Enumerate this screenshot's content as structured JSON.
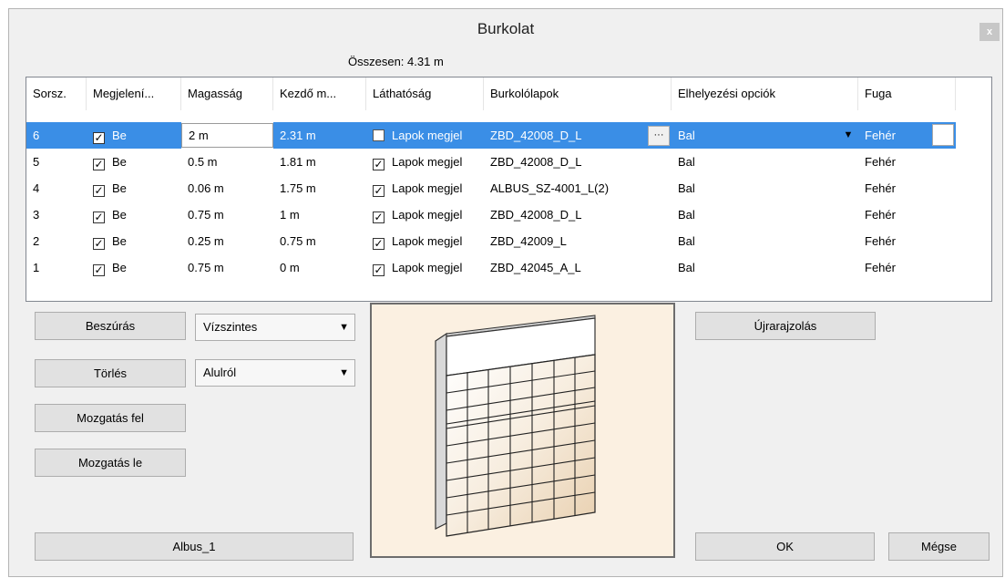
{
  "window": {
    "title": "Burkolat",
    "close_label": "x"
  },
  "summary": "Összesen: 4.31 m",
  "columns": [
    "Sorsz.",
    "Megjelení...",
    "Magasság",
    "Kezdő m...",
    "Láthatóság",
    "Burkolólapok",
    "Elhelyezési opciók",
    "Fuga"
  ],
  "rows": [
    {
      "num": "6",
      "show": "Be",
      "show_checked": true,
      "height": "2 m",
      "start": "2.31 m",
      "vis": "Lapok megjel",
      "vis_checked": false,
      "tile": "ZBD_42008_D_L",
      "place": "Bal",
      "grout": "Fehér",
      "selected": true
    },
    {
      "num": "5",
      "show": "Be",
      "show_checked": true,
      "height": "0.5 m",
      "start": "1.81 m",
      "vis": "Lapok megjel",
      "vis_checked": true,
      "tile": "ZBD_42008_D_L",
      "place": "Bal",
      "grout": "Fehér",
      "selected": false
    },
    {
      "num": "4",
      "show": "Be",
      "show_checked": true,
      "height": "0.06 m",
      "start": "1.75 m",
      "vis": "Lapok megjel",
      "vis_checked": true,
      "tile": "ALBUS_SZ-4001_L(2)",
      "place": "Bal",
      "grout": "Fehér",
      "selected": false
    },
    {
      "num": "3",
      "show": "Be",
      "show_checked": true,
      "height": "0.75 m",
      "start": "1 m",
      "vis": "Lapok megjel",
      "vis_checked": true,
      "tile": "ZBD_42008_D_L",
      "place": "Bal",
      "grout": "Fehér",
      "selected": false
    },
    {
      "num": "2",
      "show": "Be",
      "show_checked": true,
      "height": "0.25 m",
      "start": "0.75 m",
      "vis": "Lapok megjel",
      "vis_checked": true,
      "tile": "ZBD_42009_L",
      "place": "Bal",
      "grout": "Fehér",
      "selected": false
    },
    {
      "num": "1",
      "show": "Be",
      "show_checked": true,
      "height": "0.75 m",
      "start": "0 m",
      "vis": "Lapok megjel",
      "vis_checked": true,
      "tile": "ZBD_42045_A_L",
      "place": "Bal",
      "grout": "Fehér",
      "selected": false
    }
  ],
  "buttons": {
    "insert": "Beszúrás",
    "delete": "Törlés",
    "move_up": "Mozgatás fel",
    "move_down": "Mozgatás le",
    "preset": "Albus_1",
    "redraw": "Újrarajzolás",
    "ok": "OK",
    "cancel": "Mégse"
  },
  "selects": {
    "direction": "Vízszintes",
    "origin": "Alulról"
  },
  "colors": {
    "selection": "#3a8ee6",
    "dialog_bg": "#f0f0f0",
    "preview_bg": "#fbf0e1"
  }
}
